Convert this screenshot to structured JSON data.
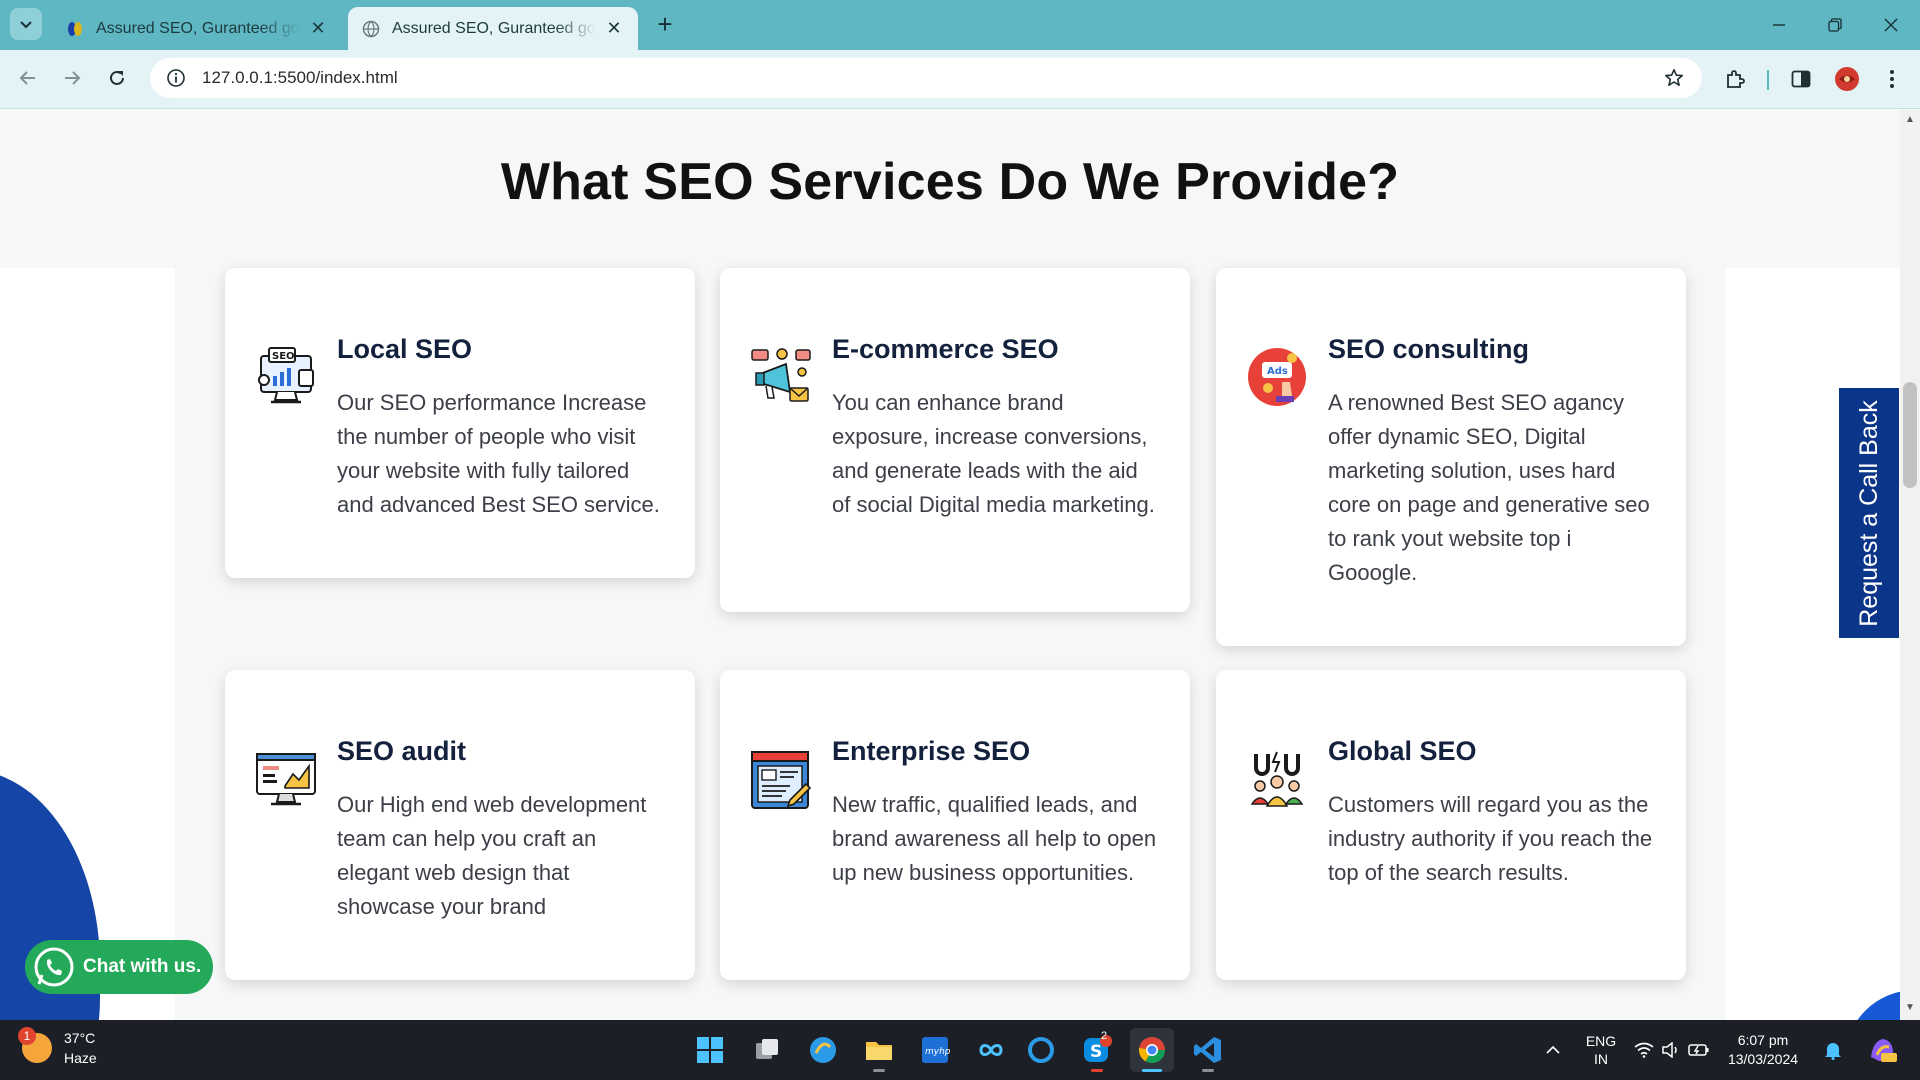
{
  "browser": {
    "tabs": [
      {
        "title": "Assured SEO, Guranteed google ranking",
        "active": false
      },
      {
        "title": "Assured SEO, Guranteed google ranking",
        "active": true
      }
    ],
    "new_tab_label": "+",
    "url": "127.0.0.1:5500/index.html"
  },
  "page": {
    "heading": "What SEO Services Do We Provide?",
    "services": [
      {
        "title": "Local SEO",
        "text": "Our SEO performance Increase the number of people who visit your website with fully tailored and advanced Best SEO service.",
        "icon": "seo-monitor-icon"
      },
      {
        "title": "E-commerce SEO",
        "text": "You can enhance brand exposure, increase conversions, and generate leads with the aid of social Digital media marketing.",
        "icon": "megaphone-icon"
      },
      {
        "title": "SEO consulting",
        "text": "A renowned Best SEO agancy offer dynamic SEO, Digital marketing solution, uses hard core on page and generative seo to rank yout website top i Gooogle.",
        "icon": "ads-icon"
      },
      {
        "title": "SEO audit",
        "text": "Our High end web development team can help you craft an elegant web design that showcase your brand",
        "icon": "monitor-chart-icon"
      },
      {
        "title": "Enterprise SEO",
        "text": "New traffic, qualified leads, and brand awareness all help to open up new business opportunities.",
        "icon": "web-edit-icon"
      },
      {
        "title": "Global SEO",
        "text": "Customers will regard you as the industry authority if you reach the top of the search results.",
        "icon": "magnet-people-icon"
      }
    ],
    "chat_label": "Chat with us.",
    "callback_label": "Request a Call Back"
  },
  "taskbar": {
    "weather_temp": "37°C",
    "weather_desc": "Haze",
    "weather_badge": "1",
    "lang_line1": "ENG",
    "lang_line2": "IN",
    "time": "6:07 pm",
    "date": "13/03/2024",
    "skype_badge": "2"
  },
  "colors": {
    "tab_strip": "#5fb7c3",
    "toolbar": "#e4f3f5",
    "callback_bg": "#0b3588",
    "chat_bg": "#24a85a",
    "card_title": "#14213d"
  }
}
